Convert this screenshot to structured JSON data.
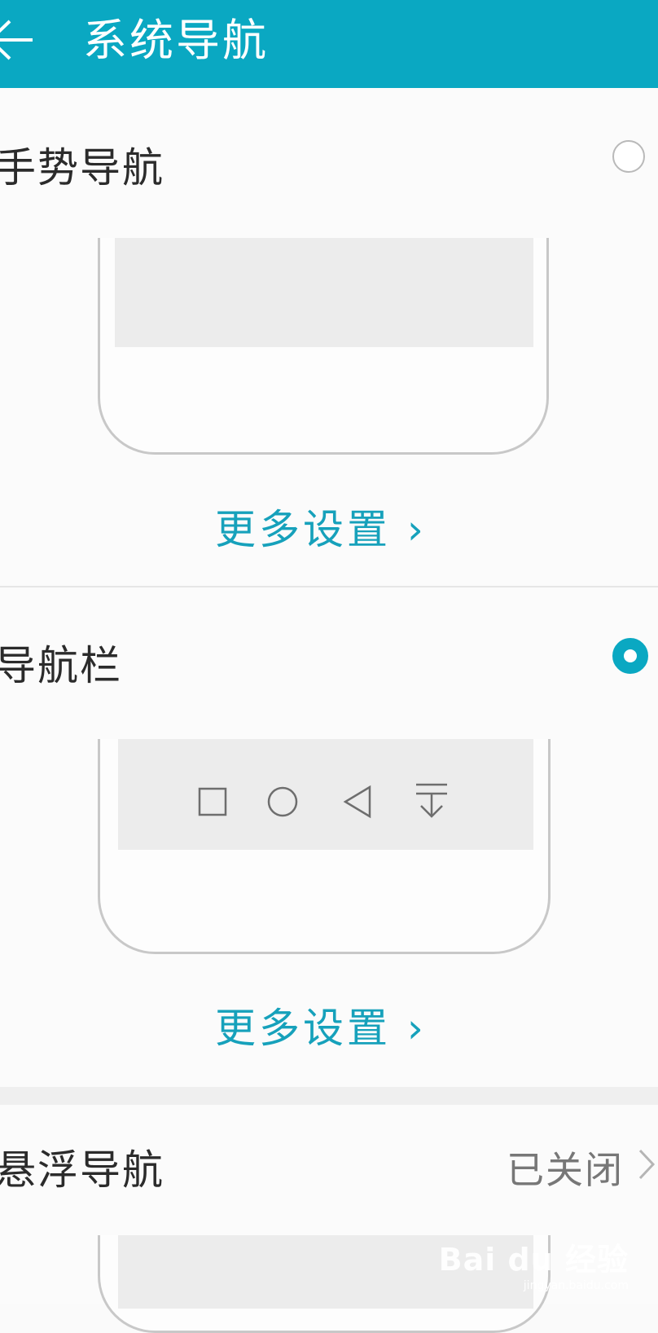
{
  "header": {
    "title": "系统导航",
    "back_icon": "arrow-left-icon",
    "color": "#0aa8c2"
  },
  "options": [
    {
      "label": "手势导航",
      "selected": false,
      "more_settings": "更多设置 ›"
    },
    {
      "label": "导航栏",
      "selected": true,
      "more_settings": "更多设置 ›",
      "nav_icons": [
        "square-icon",
        "circle-icon",
        "triangle-back-icon",
        "hide-bar-icon"
      ]
    },
    {
      "label": "悬浮导航",
      "status": "已关闭"
    }
  ],
  "accent_color": "#16a1bb",
  "watermark": {
    "logo": "Bai du 经验",
    "sub": "jingyan.baidu.com"
  }
}
